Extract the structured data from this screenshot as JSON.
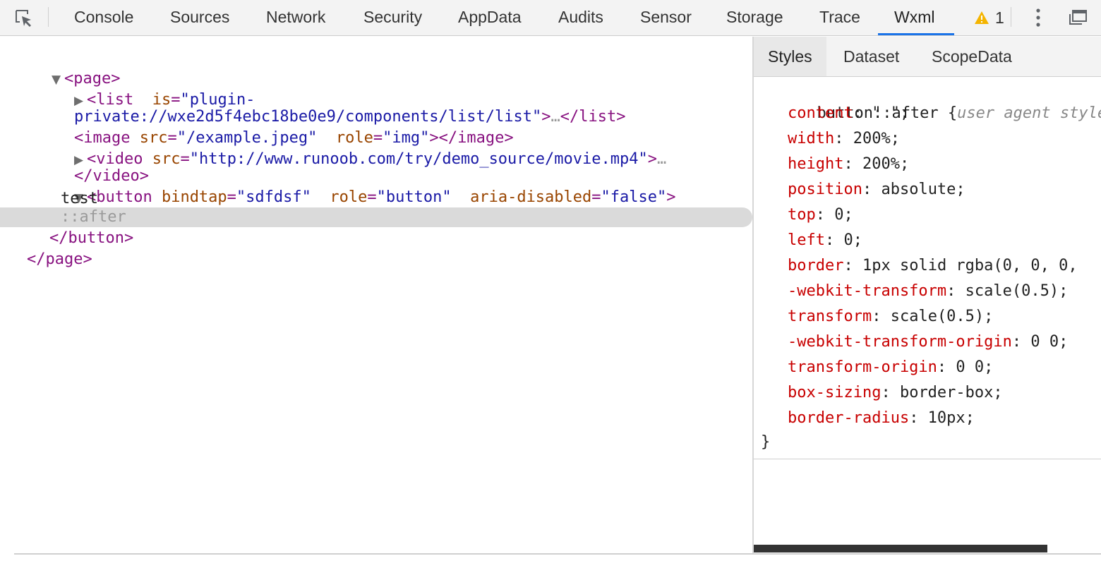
{
  "toolbar": {
    "tabs": [
      "Console",
      "Sources",
      "Network",
      "Security",
      "AppData",
      "Audits",
      "Sensor",
      "Storage",
      "Trace",
      "Wxml"
    ],
    "active_tab": "Wxml",
    "warning_count": "1",
    "icons": [
      "inspect-element-icon",
      "warning-icon",
      "more-vert-icon",
      "undock-icon"
    ],
    "accent_color": "#1a73e8"
  },
  "tree": {
    "page_open": "<page>",
    "list_open": "<list",
    "list_attr": "is",
    "list_val_1": "\"plugin-",
    "list_val_2": "private://wxe2d5f4ebc18be0e9/components/list/list\"",
    "list_close": ">",
    "list_ellipsis": "…",
    "list_end": "</list>",
    "image_open": "<image",
    "image_attr_src": "src",
    "image_val_src": "\"/example.jpeg\"",
    "image_attr_role": "role",
    "image_val_role": "\"img\"",
    "image_close": "></image>",
    "video_open": "<video",
    "video_attr_src": "src",
    "video_val_src": "\"http://www.runoob.com/try/demo_source/movie.mp4\"",
    "video_close": ">",
    "video_ellipsis": "…",
    "video_end": "</video>",
    "button_open": "<button",
    "button_attr_bindtap": "bindtap",
    "button_val_bindtap": "\"sdfdsf\"",
    "button_attr_role": "role",
    "button_val_role": "\"button\"",
    "button_attr_aria": "aria-disabled",
    "button_val_aria": "\"false\"",
    "button_gt": ">",
    "button_text": "test",
    "pseudo_after": "::after",
    "button_end": "</button>",
    "page_end": "</page>"
  },
  "sidebar": {
    "tabs": [
      "Styles",
      "Dataset",
      "ScopeData"
    ],
    "active_tab": "Styles",
    "rule": {
      "selector": "button::after {",
      "origin": "user agent style…",
      "declarations": [
        {
          "prop": "content",
          "value": " \" \";"
        },
        {
          "prop": "width",
          "value": " 200%;"
        },
        {
          "prop": "height",
          "value": " 200%;"
        },
        {
          "prop": "position",
          "value": " absolute;"
        },
        {
          "prop": "top",
          "value": " 0;"
        },
        {
          "prop": "left",
          "value": " 0;"
        },
        {
          "prop": "border",
          "value": " 1px solid rgba(0, 0, 0,"
        },
        {
          "prop": "-webkit-transform",
          "value": " scale(0.5);"
        },
        {
          "prop": "transform",
          "value": " scale(0.5);"
        },
        {
          "prop": "-webkit-transform-origin",
          "value": " 0 0;"
        },
        {
          "prop": "transform-origin",
          "value": " 0 0;"
        },
        {
          "prop": "box-sizing",
          "value": " border-box;"
        },
        {
          "prop": "border-radius",
          "value": " 10px;"
        }
      ],
      "close": "}"
    }
  }
}
